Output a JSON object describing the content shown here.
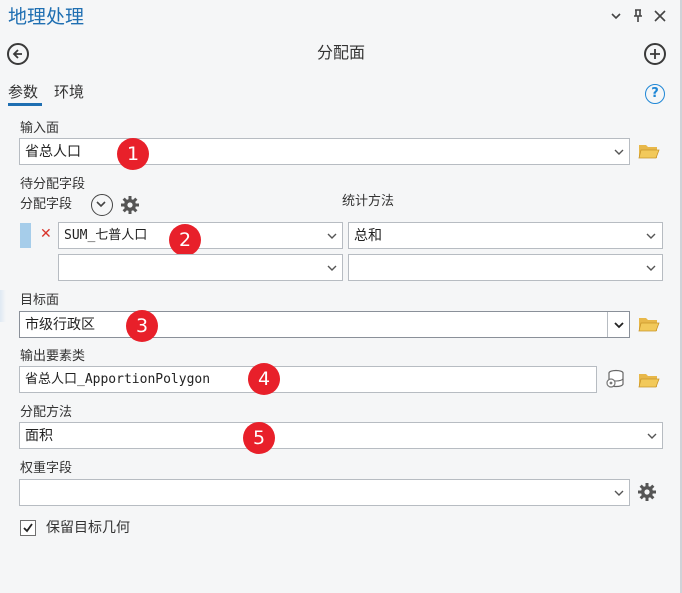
{
  "window": {
    "title": "地理处理"
  },
  "tool": {
    "title": "分配面"
  },
  "tabs": [
    {
      "label": "参数"
    },
    {
      "label": "环境"
    }
  ],
  "params": {
    "input_label": "输入面",
    "input_value": "省总人口",
    "fields_label": "待分配字段",
    "fields_sub_label": "分配字段",
    "stats_label": "统计方法",
    "field_row_1_value": "SUM_七普人口",
    "stat_row_1_value": "总和",
    "field_row_2_value": "",
    "stat_row_2_value": "",
    "target_label": "目标面",
    "target_value": "市级行政区",
    "output_label": "输出要素类",
    "output_value": "省总人口_ApportionPolygon",
    "method_label": "分配方法",
    "method_value": "面积",
    "weight_label": "权重字段",
    "weight_value": "",
    "keep_target_label": "保留目标几何",
    "keep_target_checked": true
  },
  "badges": [
    "1",
    "2",
    "3",
    "4",
    "5"
  ],
  "colors": {
    "accent": "#1f6fb2",
    "badge": "#e8202a",
    "folder": "#e8b84a",
    "remove": "#d9342b"
  },
  "icons": {
    "titlebar": [
      "chevron-down-icon",
      "pin-icon",
      "close-icon"
    ],
    "nav": [
      "back-arrow-icon",
      "add-circle-icon"
    ],
    "help": "help-icon"
  }
}
